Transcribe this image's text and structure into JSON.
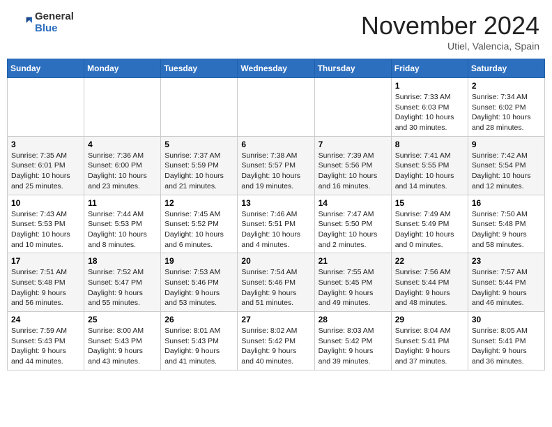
{
  "header": {
    "logo_general": "General",
    "logo_blue": "Blue",
    "month_title": "November 2024",
    "location": "Utiel, Valencia, Spain"
  },
  "days_of_week": [
    "Sunday",
    "Monday",
    "Tuesday",
    "Wednesday",
    "Thursday",
    "Friday",
    "Saturday"
  ],
  "weeks": [
    [
      {
        "day": "",
        "info": ""
      },
      {
        "day": "",
        "info": ""
      },
      {
        "day": "",
        "info": ""
      },
      {
        "day": "",
        "info": ""
      },
      {
        "day": "",
        "info": ""
      },
      {
        "day": "1",
        "info": "Sunrise: 7:33 AM\nSunset: 6:03 PM\nDaylight: 10 hours\nand 30 minutes."
      },
      {
        "day": "2",
        "info": "Sunrise: 7:34 AM\nSunset: 6:02 PM\nDaylight: 10 hours\nand 28 minutes."
      }
    ],
    [
      {
        "day": "3",
        "info": "Sunrise: 7:35 AM\nSunset: 6:01 PM\nDaylight: 10 hours\nand 25 minutes."
      },
      {
        "day": "4",
        "info": "Sunrise: 7:36 AM\nSunset: 6:00 PM\nDaylight: 10 hours\nand 23 minutes."
      },
      {
        "day": "5",
        "info": "Sunrise: 7:37 AM\nSunset: 5:59 PM\nDaylight: 10 hours\nand 21 minutes."
      },
      {
        "day": "6",
        "info": "Sunrise: 7:38 AM\nSunset: 5:57 PM\nDaylight: 10 hours\nand 19 minutes."
      },
      {
        "day": "7",
        "info": "Sunrise: 7:39 AM\nSunset: 5:56 PM\nDaylight: 10 hours\nand 16 minutes."
      },
      {
        "day": "8",
        "info": "Sunrise: 7:41 AM\nSunset: 5:55 PM\nDaylight: 10 hours\nand 14 minutes."
      },
      {
        "day": "9",
        "info": "Sunrise: 7:42 AM\nSunset: 5:54 PM\nDaylight: 10 hours\nand 12 minutes."
      }
    ],
    [
      {
        "day": "10",
        "info": "Sunrise: 7:43 AM\nSunset: 5:53 PM\nDaylight: 10 hours\nand 10 minutes."
      },
      {
        "day": "11",
        "info": "Sunrise: 7:44 AM\nSunset: 5:53 PM\nDaylight: 10 hours\nand 8 minutes."
      },
      {
        "day": "12",
        "info": "Sunrise: 7:45 AM\nSunset: 5:52 PM\nDaylight: 10 hours\nand 6 minutes."
      },
      {
        "day": "13",
        "info": "Sunrise: 7:46 AM\nSunset: 5:51 PM\nDaylight: 10 hours\nand 4 minutes."
      },
      {
        "day": "14",
        "info": "Sunrise: 7:47 AM\nSunset: 5:50 PM\nDaylight: 10 hours\nand 2 minutes."
      },
      {
        "day": "15",
        "info": "Sunrise: 7:49 AM\nSunset: 5:49 PM\nDaylight: 10 hours\nand 0 minutes."
      },
      {
        "day": "16",
        "info": "Sunrise: 7:50 AM\nSunset: 5:48 PM\nDaylight: 9 hours\nand 58 minutes."
      }
    ],
    [
      {
        "day": "17",
        "info": "Sunrise: 7:51 AM\nSunset: 5:48 PM\nDaylight: 9 hours\nand 56 minutes."
      },
      {
        "day": "18",
        "info": "Sunrise: 7:52 AM\nSunset: 5:47 PM\nDaylight: 9 hours\nand 55 minutes."
      },
      {
        "day": "19",
        "info": "Sunrise: 7:53 AM\nSunset: 5:46 PM\nDaylight: 9 hours\nand 53 minutes."
      },
      {
        "day": "20",
        "info": "Sunrise: 7:54 AM\nSunset: 5:46 PM\nDaylight: 9 hours\nand 51 minutes."
      },
      {
        "day": "21",
        "info": "Sunrise: 7:55 AM\nSunset: 5:45 PM\nDaylight: 9 hours\nand 49 minutes."
      },
      {
        "day": "22",
        "info": "Sunrise: 7:56 AM\nSunset: 5:44 PM\nDaylight: 9 hours\nand 48 minutes."
      },
      {
        "day": "23",
        "info": "Sunrise: 7:57 AM\nSunset: 5:44 PM\nDaylight: 9 hours\nand 46 minutes."
      }
    ],
    [
      {
        "day": "24",
        "info": "Sunrise: 7:59 AM\nSunset: 5:43 PM\nDaylight: 9 hours\nand 44 minutes."
      },
      {
        "day": "25",
        "info": "Sunrise: 8:00 AM\nSunset: 5:43 PM\nDaylight: 9 hours\nand 43 minutes."
      },
      {
        "day": "26",
        "info": "Sunrise: 8:01 AM\nSunset: 5:43 PM\nDaylight: 9 hours\nand 41 minutes."
      },
      {
        "day": "27",
        "info": "Sunrise: 8:02 AM\nSunset: 5:42 PM\nDaylight: 9 hours\nand 40 minutes."
      },
      {
        "day": "28",
        "info": "Sunrise: 8:03 AM\nSunset: 5:42 PM\nDaylight: 9 hours\nand 39 minutes."
      },
      {
        "day": "29",
        "info": "Sunrise: 8:04 AM\nSunset: 5:41 PM\nDaylight: 9 hours\nand 37 minutes."
      },
      {
        "day": "30",
        "info": "Sunrise: 8:05 AM\nSunset: 5:41 PM\nDaylight: 9 hours\nand 36 minutes."
      }
    ]
  ]
}
